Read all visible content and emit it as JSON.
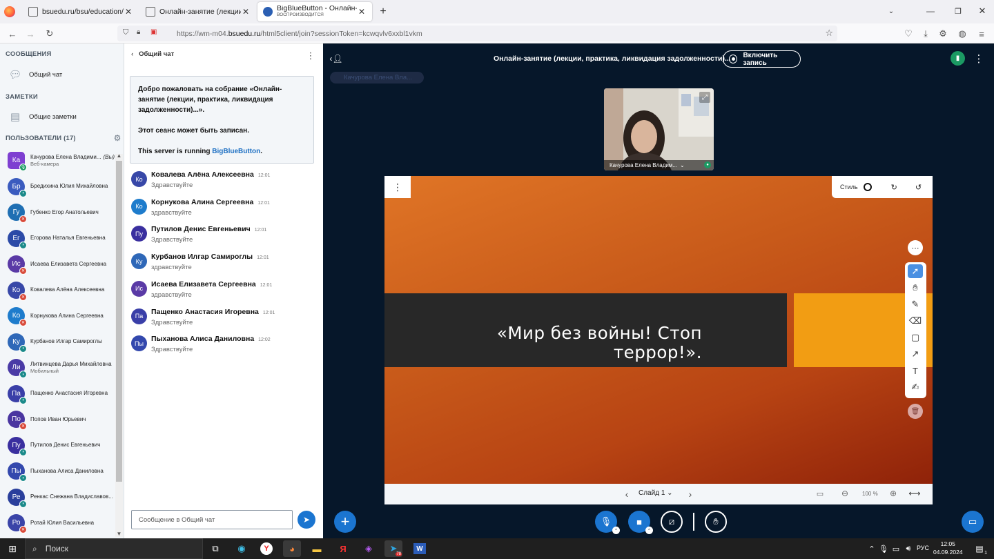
{
  "browser": {
    "tabs": [
      {
        "title": "bsuedu.ru/bsu/education/sche",
        "active": false
      },
      {
        "title": "Онлайн-занятие (лекции, прак",
        "active": false
      },
      {
        "title": "BigBlueButton - Онлайн-заняти",
        "subtitle": "ВОСПРОИЗВОДИТСЯ",
        "active": true
      }
    ],
    "url": "https://wm-m04.bsuedu.ru/html5client/join?sessionToken=kcwqvlv6xxbl1vkm",
    "url_prefix": "https://wm-m04.",
    "url_domain": "bsuedu.ru",
    "url_rest": "/html5client/join?sessionToken=kcwqvlv6xxbl1vkm"
  },
  "sidebar": {
    "messages_header": "СООБЩЕНИЯ",
    "public_chat": "Общий чат",
    "notes_header": "ЗАМЕТКИ",
    "shared_notes": "Общие заметки",
    "users_header": "ПОЛЬЗОВАТЕЛИ (17)",
    "users": [
      {
        "initials": "Ка",
        "name": "Качурова Елена Владими...",
        "you": "(Вы)",
        "sub": "Веб-камера",
        "color": "#7e3fd1",
        "square": true,
        "badge": "mic"
      },
      {
        "initials": "Бр",
        "name": "Бредихина Юлия Михайловна",
        "sub": "",
        "color": "#3a5bbf",
        "square": false,
        "badge": "listen"
      },
      {
        "initials": "Гу",
        "name": "Губенко Егор Анатольевич",
        "sub": "",
        "color": "#1f6fb3",
        "square": false,
        "badge": "muted"
      },
      {
        "initials": "Ег",
        "name": "Егорова Наталья Евгеньевна",
        "sub": "",
        "color": "#2b4aa7",
        "square": false,
        "badge": "listen"
      },
      {
        "initials": "Ис",
        "name": "Исаева Елизавета Сергеевна",
        "sub": "",
        "color": "#5a3aa6",
        "square": false,
        "badge": "muted"
      },
      {
        "initials": "Ко",
        "name": "Ковалева Алёна Алексеевна",
        "sub": "",
        "color": "#3848a8",
        "square": false,
        "badge": "muted"
      },
      {
        "initials": "Ко",
        "name": "Корнукова Алина Сергеевна",
        "sub": "",
        "color": "#1e7ccc",
        "square": false,
        "badge": "muted"
      },
      {
        "initials": "Ку",
        "name": "Курбанов Илгар Самироглы",
        "sub": "",
        "color": "#2f68b8",
        "square": false,
        "badge": "listen"
      },
      {
        "initials": "Ли",
        "name": "Литвинцева Дарья Михайловна",
        "sub": "Мобильный",
        "color": "#4a3aa6",
        "square": false,
        "badge": "listen"
      },
      {
        "initials": "Па",
        "name": "Пащенко Анастасия Игоревна",
        "sub": "",
        "color": "#3a3fa8",
        "square": false,
        "badge": "listen"
      },
      {
        "initials": "По",
        "name": "Попов Иван Юрьевич",
        "sub": "",
        "color": "#4a35a0",
        "square": false,
        "badge": "muted"
      },
      {
        "initials": "Пу",
        "name": "Путилов Денис Евгеньевич",
        "sub": "",
        "color": "#3a2f9f",
        "square": false,
        "badge": "listen"
      },
      {
        "initials": "Пы",
        "name": "Пыханова Алиса Даниловна",
        "sub": "",
        "color": "#3348ad",
        "square": false,
        "badge": "listen"
      },
      {
        "initials": "Ре",
        "name": "Ренкас Снежана Владиславов...",
        "sub": "",
        "color": "#2a3f9c",
        "square": false,
        "badge": "listen"
      },
      {
        "initials": "Ро",
        "name": "Ротай Юлия Васильевна",
        "sub": "",
        "color": "#3a44a8",
        "square": false,
        "badge": "muted"
      }
    ]
  },
  "chat": {
    "title": "Общий чат",
    "welcome_line1": "Добро пожаловать на собрание «Онлайн-занятие (лекции, практика, ликвидация задолженности)...».",
    "welcome_line2": "Этот сеанс может быть записан.",
    "welcome_line3_prefix": "This server is running ",
    "welcome_link": "BigBlueButton",
    "welcome_suffix": ".",
    "messages": [
      {
        "initials": "Ко",
        "name": "Ковалева Алёна Алексеевна",
        "time": "12:01",
        "text": "Здравствуйте",
        "color": "#3848a8"
      },
      {
        "initials": "Ко",
        "name": "Корнукова Алина Сергеевна",
        "time": "12:01",
        "text": "здравствуйте",
        "color": "#1e7ccc"
      },
      {
        "initials": "Пу",
        "name": "Путилов Денис Евгеньевич",
        "time": "12:01",
        "text": "Здравствуйте",
        "color": "#3a2f9f"
      },
      {
        "initials": "Ку",
        "name": "Курбанов Илгар Самироглы",
        "time": "12:01",
        "text": "здравствуйте",
        "color": "#2f68b8"
      },
      {
        "initials": "Ис",
        "name": "Исаева Елизавета Сергеевна",
        "time": "12:01",
        "text": "здравствуйте",
        "color": "#5a3aa6"
      },
      {
        "initials": "Па",
        "name": "Пащенко Анастасия Игоревна",
        "time": "12:01",
        "text": "Здравствуйте",
        "color": "#3a3fa8"
      },
      {
        "initials": "Пы",
        "name": "Пыханова Алиса Даниловна",
        "time": "12:02",
        "text": "Здравствуйте",
        "color": "#3348ad"
      }
    ],
    "input_placeholder": "Сообщение в Общий чат"
  },
  "main": {
    "meeting_title": "Онлайн-занятие (лекции, практика, ликвидация задолженности)...",
    "record_label": "Включить запись",
    "talking": "Качурова Елена Вла...",
    "webcam_name": "Качурова Елена Владим...",
    "slide_text_line1": "«Мир без войны! Стоп",
    "slide_text_line2": "террор!».",
    "style_label": "Стиль",
    "slide_label": "Слайд 1",
    "zoom": "100 %"
  },
  "taskbar": {
    "search_label": "Поиск",
    "lang": "РУС",
    "time": "12:05",
    "date": "04.09.2024",
    "telegram_badge": "78",
    "notif_count": "1"
  },
  "colors": {
    "accent": "#1b75d0",
    "dark_bg": "#06172a",
    "slide_orange": "#c85a1a",
    "slide_band": "#282828",
    "slide_yellow": "#f29d13"
  }
}
